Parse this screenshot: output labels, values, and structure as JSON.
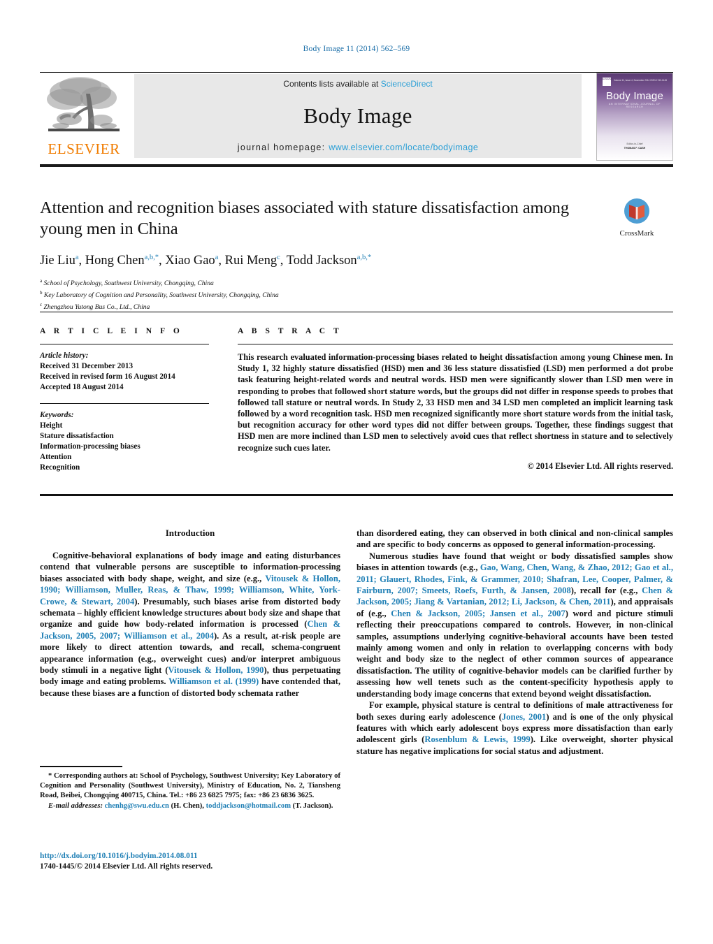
{
  "running_head": "Body Image 11 (2014) 562–569",
  "header": {
    "contents_prefix": "Contents lists available at ",
    "sciencedirect": "ScienceDirect",
    "journal_name": "Body Image",
    "homepage_prefix": "journal homepage:",
    "homepage_url": "www.elsevier.com/locate/bodyimage",
    "elsevier_wordmark": "ELSEVIER",
    "cover": {
      "title": "Body Image",
      "subtitle": "AN INTERNATIONAL JOURNAL OF RESEARCH",
      "top_left_badge": "ELSEVIER",
      "top_mid": "Volume 11, Issue 4, November 2014",
      "top_right": "ISSN 1740-1445",
      "footer_label": "Editor-in-Chief",
      "footer_name": "THOMAS F. CASH"
    }
  },
  "crossmark": {
    "label": "CrossMark"
  },
  "article": {
    "title": "Attention and recognition biases associated with stature dissatisfaction among young men in China",
    "authors": [
      {
        "name": "Jie Liu",
        "sup": "a"
      },
      {
        "name": "Hong Chen",
        "sup": "a,b,*"
      },
      {
        "name": "Xiao Gao",
        "sup": "a"
      },
      {
        "name": "Rui Meng",
        "sup": "c"
      },
      {
        "name": "Todd Jackson",
        "sup": "a,b,*"
      }
    ],
    "affiliations": [
      {
        "sup": "a",
        "text": "School of Psychology, Southwest University, Chongqing, China"
      },
      {
        "sup": "b",
        "text": "Key Laboratory of Cognition and Personality, Southwest University, Chongqing, China"
      },
      {
        "sup": "c",
        "text": "Zhengzhou Yutong Bus Co., Ltd., China"
      }
    ]
  },
  "article_info": {
    "heading": "A R T I C L E   I N F O",
    "history_label": "Article history:",
    "history": [
      "Received 31 December 2013",
      "Received in revised form 16 August 2014",
      "Accepted 18 August 2014"
    ],
    "keywords_label": "Keywords:",
    "keywords": [
      "Height",
      "Stature dissatisfaction",
      "Information-processing biases",
      "Attention",
      "Recognition"
    ]
  },
  "abstract": {
    "heading": "A B S T R A C T",
    "text": "This research evaluated information-processing biases related to height dissatisfaction among young Chinese men. In Study 1, 32 highly stature dissatisfied (HSD) men and 36 less stature dissatisfied (LSD) men performed a dot probe task featuring height-related words and neutral words. HSD men were significantly slower than LSD men were in responding to probes that followed short stature words, but the groups did not differ in response speeds to probes that followed tall stature or neutral words. In Study 2, 33 HSD men and 34 LSD men completed an implicit learning task followed by a word recognition task. HSD men recognized significantly more short stature words from the initial task, but recognition accuracy for other word types did not differ between groups. Together, these findings suggest that HSD men are more inclined than LSD men to selectively avoid cues that reflect shortness in stature and to selectively recognize such cues later.",
    "copyright": "© 2014 Elsevier Ltd. All rights reserved."
  },
  "body": {
    "intro_heading": "Introduction",
    "left_paragraphs": [
      {
        "segments": [
          {
            "t": "Cognitive-behavioral explanations of body image and eating disturbances contend that vulnerable persons are susceptible to information-processing biases associated with body shape, weight, and size (e.g., ",
            "link": false
          },
          {
            "t": "Vitousek & Hollon, 1990; Williamson, Muller, Reas, & Thaw, 1999; Williamson, White, York-Crowe, & Stewart, 2004",
            "link": true
          },
          {
            "t": "). Presumably, such biases arise from distorted body schemata – highly efficient knowledge structures about body size and shape that organize and guide how body-related information is processed (",
            "link": false
          },
          {
            "t": "Chen & Jackson, 2005, 2007; Williamson et al., 2004",
            "link": true
          },
          {
            "t": "). As a result, at-risk people are more likely to direct attention towards, and recall, schema-congruent appearance information (e.g., overweight cues) and/or interpret ambiguous body stimuli in a negative light (",
            "link": false
          },
          {
            "t": "Vitousek & Hollon, 1990",
            "link": true
          },
          {
            "t": "), thus perpetuating body image and eating problems. ",
            "link": false
          },
          {
            "t": "Williamson et al. (1999)",
            "link": true
          },
          {
            "t": " have contended that, because these biases are a function of distorted body schemata rather",
            "link": false
          }
        ]
      }
    ],
    "right_paragraphs": [
      {
        "no_indent": true,
        "segments": [
          {
            "t": "than disordered eating, they can observed in both clinical and non-clinical samples and are specific to body concerns as opposed to general information-processing.",
            "link": false
          }
        ]
      },
      {
        "segments": [
          {
            "t": "Numerous studies have found that weight or body dissatisfied samples show biases in attention towards (e.g., ",
            "link": false
          },
          {
            "t": "Gao, Wang, Chen, Wang, & Zhao, 2012; Gao et al., 2011; Glauert, Rhodes, Fink, & Grammer, 2010; Shafran, Lee, Cooper, Palmer, & Fairburn, 2007; Smeets, Roefs, Furth, & Jansen, 2008",
            "link": true
          },
          {
            "t": "), recall for (e.g., ",
            "link": false
          },
          {
            "t": "Chen & Jackson, 2005; Jiang & Vartanian, 2012; Li, Jackson, & Chen, 2011",
            "link": true
          },
          {
            "t": "), and appraisals of (e.g., ",
            "link": false
          },
          {
            "t": "Chen & Jackson, 2005; Jansen et al., 2007",
            "link": true
          },
          {
            "t": ") word and picture stimuli reflecting their preoccupations compared to controls. However, in non-clinical samples, assumptions underlying cognitive-behavioral accounts have been tested mainly among women and only in relation to overlapping concerns with body weight and body size to the neglect of other common sources of appearance dissatisfaction. The utility of cognitive-behavior models can be clarified further by assessing how well tenets such as the content-specificity hypothesis apply to understanding body image concerns that extend beyond weight dissatisfaction.",
            "link": false
          }
        ]
      },
      {
        "segments": [
          {
            "t": "For example, physical stature is central to definitions of male attractiveness for both sexes during early adolescence (",
            "link": false
          },
          {
            "t": "Jones, 2001",
            "link": true
          },
          {
            "t": ") and is one of the only physical features with which early adolescent boys express more dissatisfaction than early adolescent girls (",
            "link": false
          },
          {
            "t": "Rosenblum & Lewis, 1999",
            "link": true
          },
          {
            "t": "). Like overweight, shorter physical stature has negative implications for social status and adjustment.",
            "link": false
          }
        ]
      }
    ]
  },
  "footnote": {
    "corresponding": "* Corresponding authors at: School of Psychology, Southwest University; Key Laboratory of Cognition and Personality (Southwest University), Ministry of Education, No. 2, Tiansheng Road, Beibei, Chongqing 400715, China. Tel.: +86 23 6825 7975; fax: +86 23 6836 3625.",
    "email_label": "E-mail addresses:",
    "email1": "chenhg@swu.edu.cn",
    "email1_owner": "(H. Chen),",
    "email2": "toddjackson@hotmail.com",
    "email2_owner": "(T. Jackson)."
  },
  "doi": {
    "url": "http://dx.doi.org/10.1016/j.bodyim.2014.08.011",
    "rights": "1740-1445/© 2014 Elsevier Ltd. All rights reserved."
  },
  "colors": {
    "link": "#1f7fb5",
    "sciencedirect": "#2a9fd6",
    "elsevier_orange": "#f07c00",
    "rule": "#111111"
  }
}
